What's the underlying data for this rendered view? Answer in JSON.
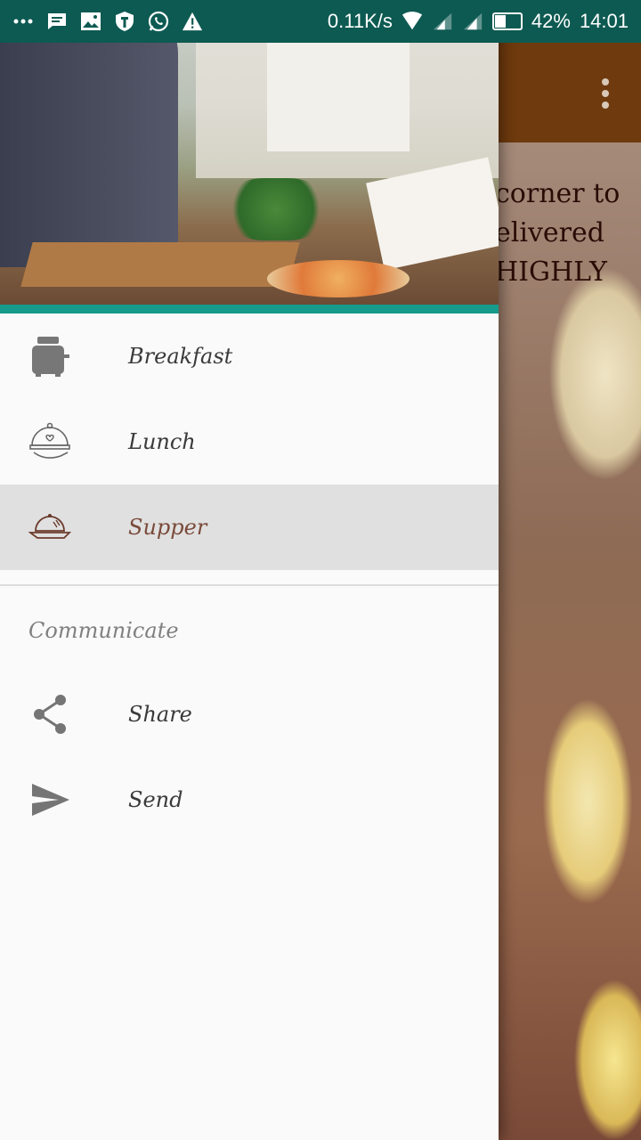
{
  "status_bar": {
    "net_speed": "0.11K/s",
    "battery": "42%",
    "battery_level": 0.42,
    "time": "14:01"
  },
  "menu": {
    "items": [
      {
        "label": "Breakfast",
        "icon": "toaster-icon",
        "selected": false
      },
      {
        "label": "Lunch",
        "icon": "cloche-icon",
        "selected": false
      },
      {
        "label": "Supper",
        "icon": "serving-dish-icon",
        "selected": true
      }
    ],
    "section_title": "Communicate",
    "communicate_items": [
      {
        "label": "Share",
        "icon": "share-icon"
      },
      {
        "label": "Send",
        "icon": "send-icon"
      }
    ]
  },
  "background": {
    "text_lines": [
      "corner to",
      "elivered",
      "HIGHLY"
    ]
  },
  "colors": {
    "status_bar": "#0d5a52",
    "drawer_header_accent": "#169a8c",
    "app_toolbar": "#6e3a0e",
    "selected_item_bg": "#e0e0e0"
  }
}
